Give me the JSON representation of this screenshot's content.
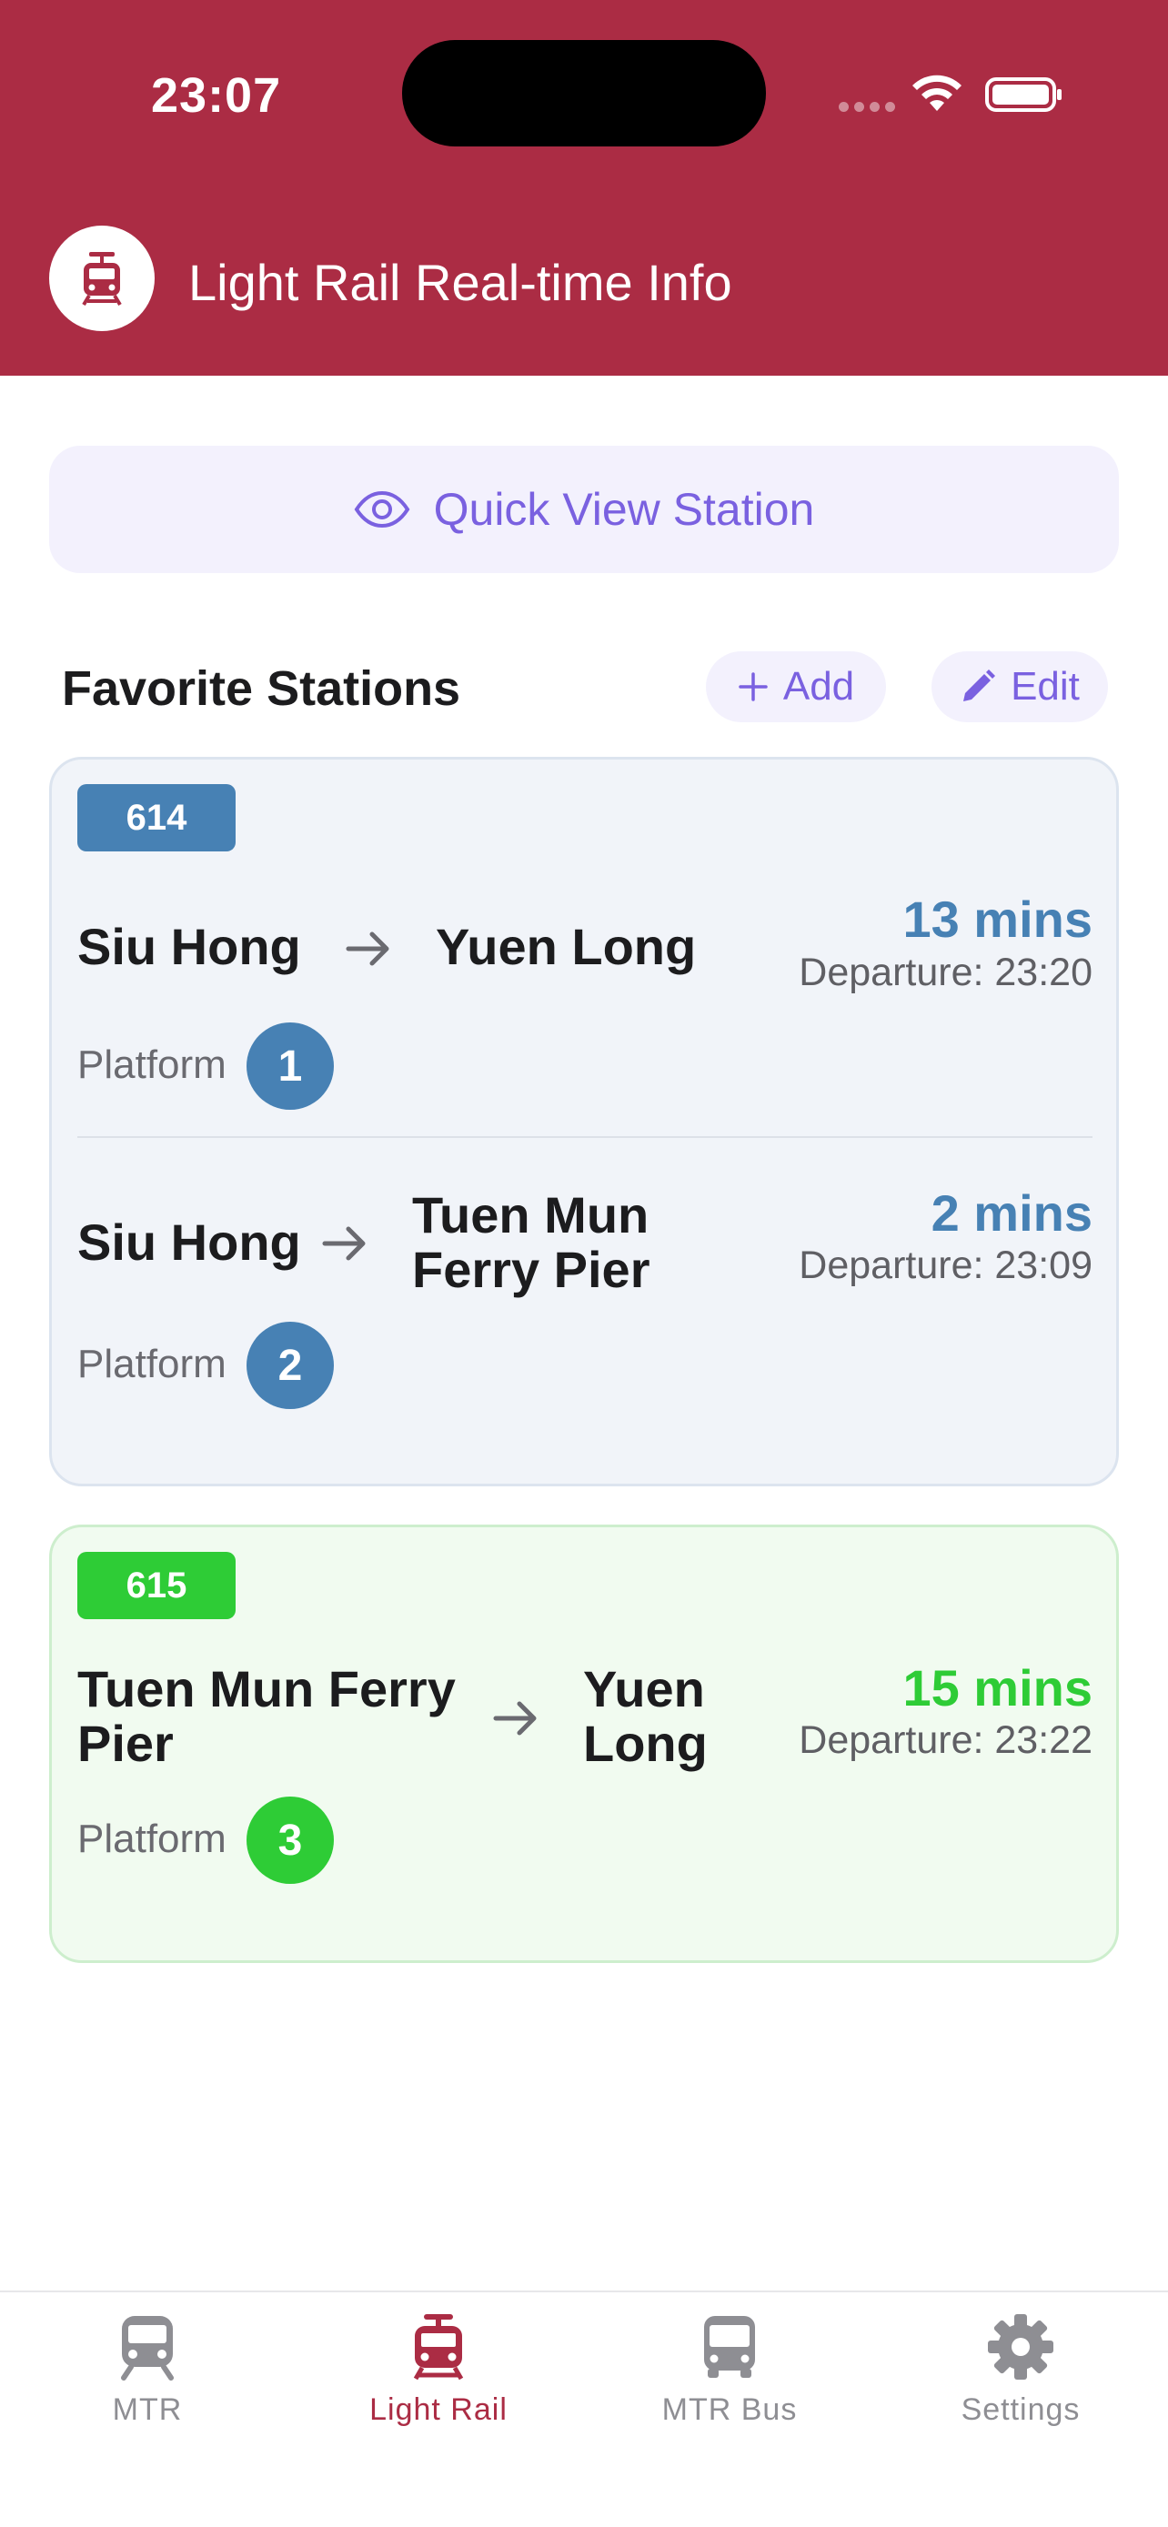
{
  "status_bar": {
    "time": "23:07"
  },
  "header": {
    "title": "Light Rail Real-time Info",
    "icon": "tram-icon"
  },
  "quick_view": {
    "label": "Quick View Station",
    "icon": "eye-icon"
  },
  "favorites": {
    "title": "Favorite Stations",
    "add_label": "Add",
    "edit_label": "Edit"
  },
  "routes": [
    {
      "route": "614",
      "color": "#4781b4",
      "departures": [
        {
          "from": "Siu Hong",
          "to": "Yuen Long",
          "mins": "13 mins",
          "departure": "Departure: 23:20",
          "platform_label": "Platform",
          "platform": "1"
        },
        {
          "from": "Siu Hong",
          "to": "Tuen Mun Ferry Pier",
          "mins": "2 mins",
          "departure": "Departure: 23:09",
          "platform_label": "Platform",
          "platform": "2"
        }
      ]
    },
    {
      "route": "615",
      "color": "#2ecc36",
      "departures": [
        {
          "from": "Tuen Mun Ferry Pier",
          "to": "Yuen Long",
          "mins": "15 mins",
          "departure": "Departure: 23:22",
          "platform_label": "Platform",
          "platform": "3"
        }
      ]
    }
  ],
  "tabs": [
    {
      "label": "MTR",
      "icon": "train-icon",
      "active": false
    },
    {
      "label": "Light Rail",
      "icon": "tram-icon",
      "active": true
    },
    {
      "label": "MTR Bus",
      "icon": "bus-icon",
      "active": false
    },
    {
      "label": "Settings",
      "icon": "gear-icon",
      "active": false
    }
  ],
  "colors": {
    "brand": "#ab2c44",
    "accent": "#7a61e0",
    "route_614": "#4781b4",
    "route_615": "#2ecc36"
  }
}
